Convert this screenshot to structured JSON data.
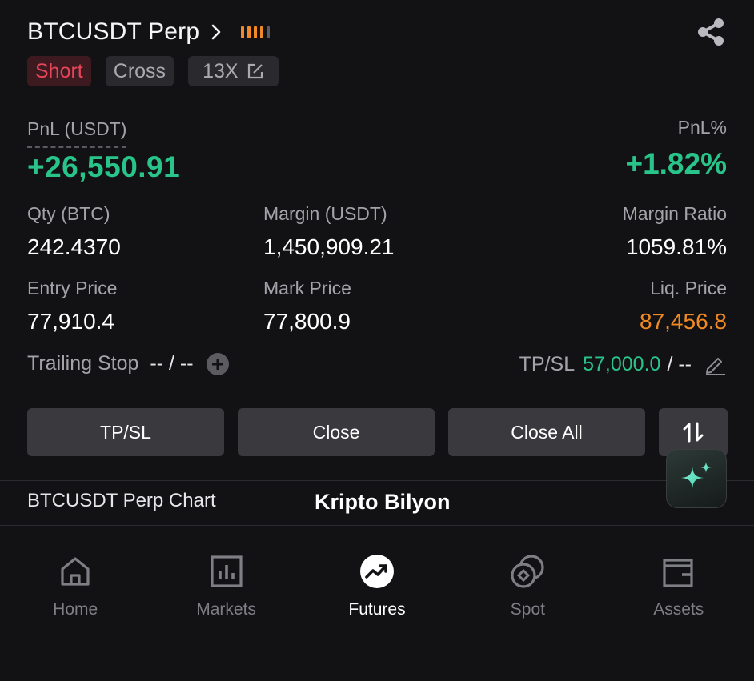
{
  "header": {
    "title": "BTCUSDT Perp",
    "bar_colors": [
      "#f08a24",
      "#f08a24",
      "#f08a24",
      "#f08a24",
      "#5a5a60"
    ]
  },
  "tags": {
    "side": "Short",
    "margin_mode": "Cross",
    "leverage": "13X"
  },
  "pnl": {
    "label": "PnL (USDT)",
    "value": "+26,550.91",
    "pct_label": "PnL%",
    "pct_value": "+1.82%"
  },
  "stats": {
    "qty_label": "Qty (BTC)",
    "qty_value": "242.4370",
    "margin_label": "Margin (USDT)",
    "margin_value": "1,450,909.21",
    "ratio_label": "Margin Ratio",
    "ratio_value": "1059.81%",
    "entry_label": "Entry Price",
    "entry_value": "77,910.4",
    "mark_label": "Mark Price",
    "mark_value": "77,800.9",
    "liq_label": "Liq. Price",
    "liq_value": "87,456.8"
  },
  "trailing": {
    "label": "Trailing Stop",
    "value": "-- / --"
  },
  "tpsl": {
    "label": "TP/SL",
    "tp_value": "57,000.0",
    "sl_value": "/ --"
  },
  "buttons": {
    "tpsl": "TP/SL",
    "close": "Close",
    "close_all": "Close All"
  },
  "chart_link": "BTCUSDT Perp Chart",
  "watermark": "Kripto Bilyon",
  "nav": [
    {
      "label": "Home",
      "icon": "home-icon"
    },
    {
      "label": "Markets",
      "icon": "markets-icon"
    },
    {
      "label": "Futures",
      "icon": "futures-icon"
    },
    {
      "label": "Spot",
      "icon": "spot-icon"
    },
    {
      "label": "Assets",
      "icon": "assets-icon"
    }
  ],
  "colors": {
    "profit": "#29c48a",
    "short": "#e8455a",
    "liq": "#f08a24"
  }
}
